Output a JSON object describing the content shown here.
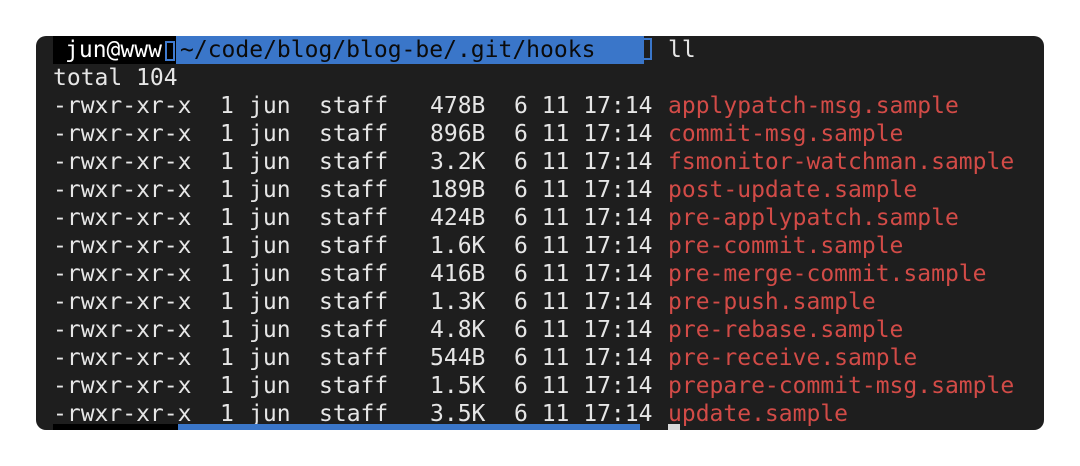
{
  "terminal": {
    "prompt": {
      "user_host": "jun@www",
      "path": "~/code/blog/blog-be/.git/hooks",
      "separator_icon": "powerline-arrow-icon"
    },
    "command": "ll",
    "total": "total 104",
    "entries": [
      {
        "permissions": "-rwxr-xr-x",
        "links": "1",
        "owner": "jun",
        "group": "staff",
        "size": "478B",
        "date": "6 11 17:14",
        "name": "applypatch-msg.sample"
      },
      {
        "permissions": "-rwxr-xr-x",
        "links": "1",
        "owner": "jun",
        "group": "staff",
        "size": "896B",
        "date": "6 11 17:14",
        "name": "commit-msg.sample"
      },
      {
        "permissions": "-rwxr-xr-x",
        "links": "1",
        "owner": "jun",
        "group": "staff",
        "size": "3.2K",
        "date": "6 11 17:14",
        "name": "fsmonitor-watchman.sample"
      },
      {
        "permissions": "-rwxr-xr-x",
        "links": "1",
        "owner": "jun",
        "group": "staff",
        "size": "189B",
        "date": "6 11 17:14",
        "name": "post-update.sample"
      },
      {
        "permissions": "-rwxr-xr-x",
        "links": "1",
        "owner": "jun",
        "group": "staff",
        "size": "424B",
        "date": "6 11 17:14",
        "name": "pre-applypatch.sample"
      },
      {
        "permissions": "-rwxr-xr-x",
        "links": "1",
        "owner": "jun",
        "group": "staff",
        "size": "1.6K",
        "date": "6 11 17:14",
        "name": "pre-commit.sample"
      },
      {
        "permissions": "-rwxr-xr-x",
        "links": "1",
        "owner": "jun",
        "group": "staff",
        "size": "416B",
        "date": "6 11 17:14",
        "name": "pre-merge-commit.sample"
      },
      {
        "permissions": "-rwxr-xr-x",
        "links": "1",
        "owner": "jun",
        "group": "staff",
        "size": "1.3K",
        "date": "6 11 17:14",
        "name": "pre-push.sample"
      },
      {
        "permissions": "-rwxr-xr-x",
        "links": "1",
        "owner": "jun",
        "group": "staff",
        "size": "4.8K",
        "date": "6 11 17:14",
        "name": "pre-rebase.sample"
      },
      {
        "permissions": "-rwxr-xr-x",
        "links": "1",
        "owner": "jun",
        "group": "staff",
        "size": "544B",
        "date": "6 11 17:14",
        "name": "pre-receive.sample"
      },
      {
        "permissions": "-rwxr-xr-x",
        "links": "1",
        "owner": "jun",
        "group": "staff",
        "size": "1.5K",
        "date": "6 11 17:14",
        "name": "prepare-commit-msg.sample"
      },
      {
        "permissions": "-rwxr-xr-x",
        "links": "1",
        "owner": "jun",
        "group": "staff",
        "size": "3.5K",
        "date": "6 11 17:14",
        "name": "update.sample"
      }
    ]
  },
  "colors": {
    "background": "#1e1e1e",
    "text": "#e6e6e6",
    "filename": "#d24b47",
    "prompt_path_bg": "#3a76c9",
    "prompt_user_bg": "#000000"
  }
}
